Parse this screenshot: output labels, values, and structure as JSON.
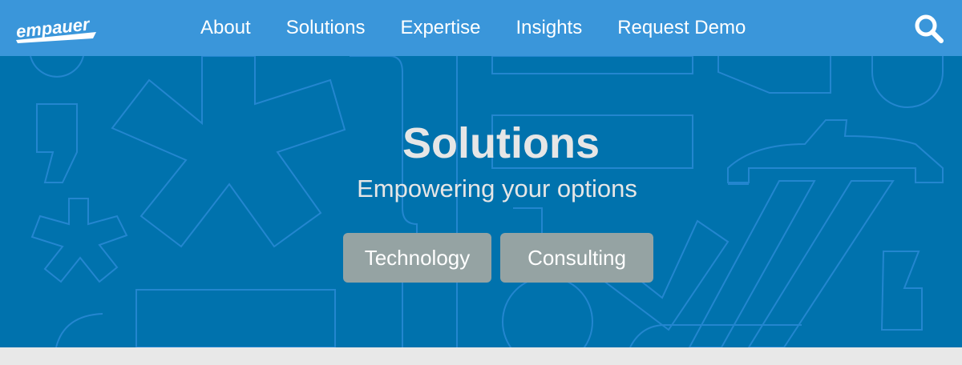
{
  "brand": {
    "logo_text": "empauer"
  },
  "nav": {
    "items": [
      {
        "label": "About"
      },
      {
        "label": "Solutions"
      },
      {
        "label": "Expertise"
      },
      {
        "label": "Insights"
      },
      {
        "label": "Request Demo"
      }
    ],
    "search_icon": "search-icon"
  },
  "hero": {
    "title": "Solutions",
    "subtitle": "Empowering your options",
    "buttons": [
      {
        "label": "Technology"
      },
      {
        "label": "Consulting"
      }
    ]
  },
  "colors": {
    "nav_bg": "#3a96da",
    "hero_bg": "#0072ad",
    "button_bg": "#95a3a3",
    "outline": "#2a8ad6",
    "footer_bg": "#e8e8e8"
  }
}
